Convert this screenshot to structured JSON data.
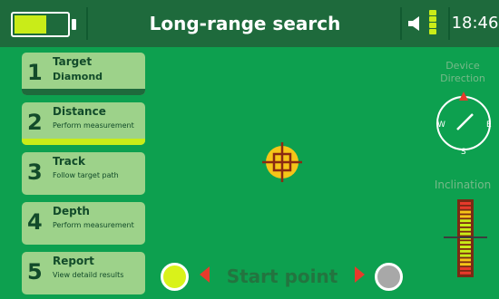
{
  "status_bar": {
    "battery_level": 0.62,
    "title": "Long-range search",
    "time": "18:46",
    "signal_bars": 4
  },
  "menu": [
    {
      "number": "1",
      "title": "Target",
      "subtitle": "Diamond",
      "state": "completed"
    },
    {
      "number": "2",
      "title": "Distance",
      "subtitle": "Perform measurement",
      "state": "active"
    },
    {
      "number": "3",
      "title": "Track",
      "subtitle": "Follow target path",
      "state": "default"
    },
    {
      "number": "4",
      "title": "Depth",
      "subtitle": "Perform measurement",
      "state": "default"
    },
    {
      "number": "5",
      "title": "Report",
      "subtitle": "View detaild results",
      "state": "default"
    }
  ],
  "bottom": {
    "label": "Start point"
  },
  "right_panel": {
    "direction_label_line1": "Device",
    "direction_label_line2": "Direction",
    "inclination_label": "Inclination",
    "compass": {
      "w": "W",
      "e": "E",
      "s": "S"
    }
  },
  "colors": {
    "background": "#0da04f",
    "header": "#1e6a3c",
    "lime": "#c9ec18",
    "button": "#9dd28a",
    "red": "#e73a2b"
  }
}
